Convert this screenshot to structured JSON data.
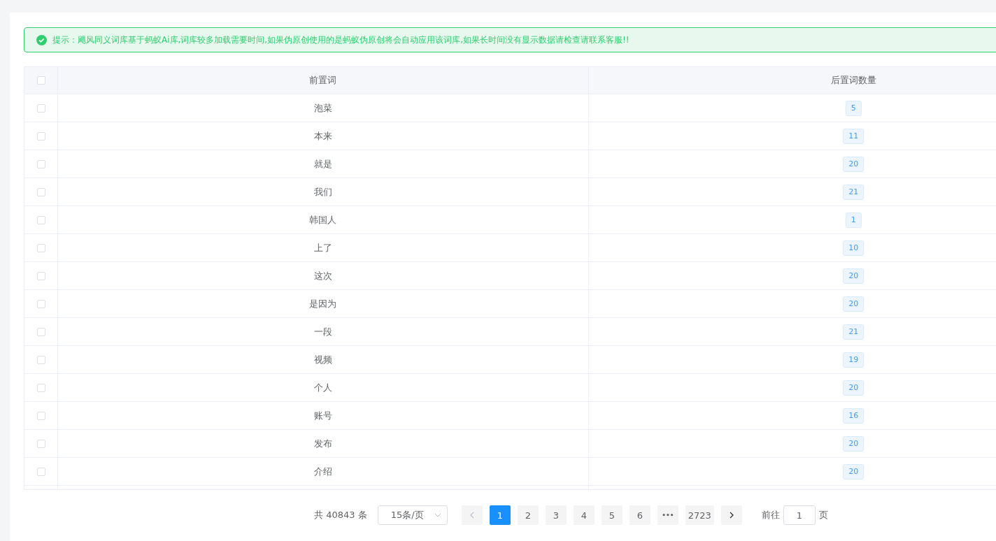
{
  "alert": {
    "kind": "success",
    "text": "提示：飓风同义词库基于蚂蚁Ai库,词库较多加载需要时间,如果伪原创使用的是蚂蚁伪原创将会自动应用该词库,如果长时间没有显示数据请检查请联系客服!!"
  },
  "table": {
    "select_all": {
      "checked": false
    },
    "columns": [
      "前置词",
      "后置词数量"
    ],
    "rows": [
      {
        "checked": false,
        "word": "泡菜",
        "count": "5"
      },
      {
        "checked": false,
        "word": "本来",
        "count": "11"
      },
      {
        "checked": false,
        "word": "就是",
        "count": "20"
      },
      {
        "checked": false,
        "word": "我们",
        "count": "21"
      },
      {
        "checked": false,
        "word": "韩国人",
        "count": "1"
      },
      {
        "checked": false,
        "word": "上了",
        "count": "10"
      },
      {
        "checked": false,
        "word": "这次",
        "count": "20"
      },
      {
        "checked": false,
        "word": "是因为",
        "count": "20"
      },
      {
        "checked": false,
        "word": "一段",
        "count": "21"
      },
      {
        "checked": false,
        "word": "视频",
        "count": "19"
      },
      {
        "checked": false,
        "word": "个人",
        "count": "20"
      },
      {
        "checked": false,
        "word": "账号",
        "count": "16"
      },
      {
        "checked": false,
        "word": "发布",
        "count": "20"
      },
      {
        "checked": false,
        "word": "介绍",
        "count": "20"
      }
    ]
  },
  "pagination": {
    "total": "共 40843 条",
    "page_size": "15条/页",
    "pages": [
      {
        "kind": "page",
        "label": "1",
        "selected": true
      },
      {
        "kind": "page",
        "label": "2",
        "selected": false
      },
      {
        "kind": "page",
        "label": "3",
        "selected": false
      },
      {
        "kind": "page",
        "label": "4",
        "selected": false
      },
      {
        "kind": "page",
        "label": "5",
        "selected": false
      },
      {
        "kind": "page",
        "label": "6",
        "selected": false
      },
      {
        "kind": "more",
        "label": "•••",
        "selected": false
      },
      {
        "kind": "page",
        "label": "2723",
        "selected": false
      }
    ],
    "jump_label": "前往",
    "jump_value": "1",
    "jump_suffix": "页"
  }
}
